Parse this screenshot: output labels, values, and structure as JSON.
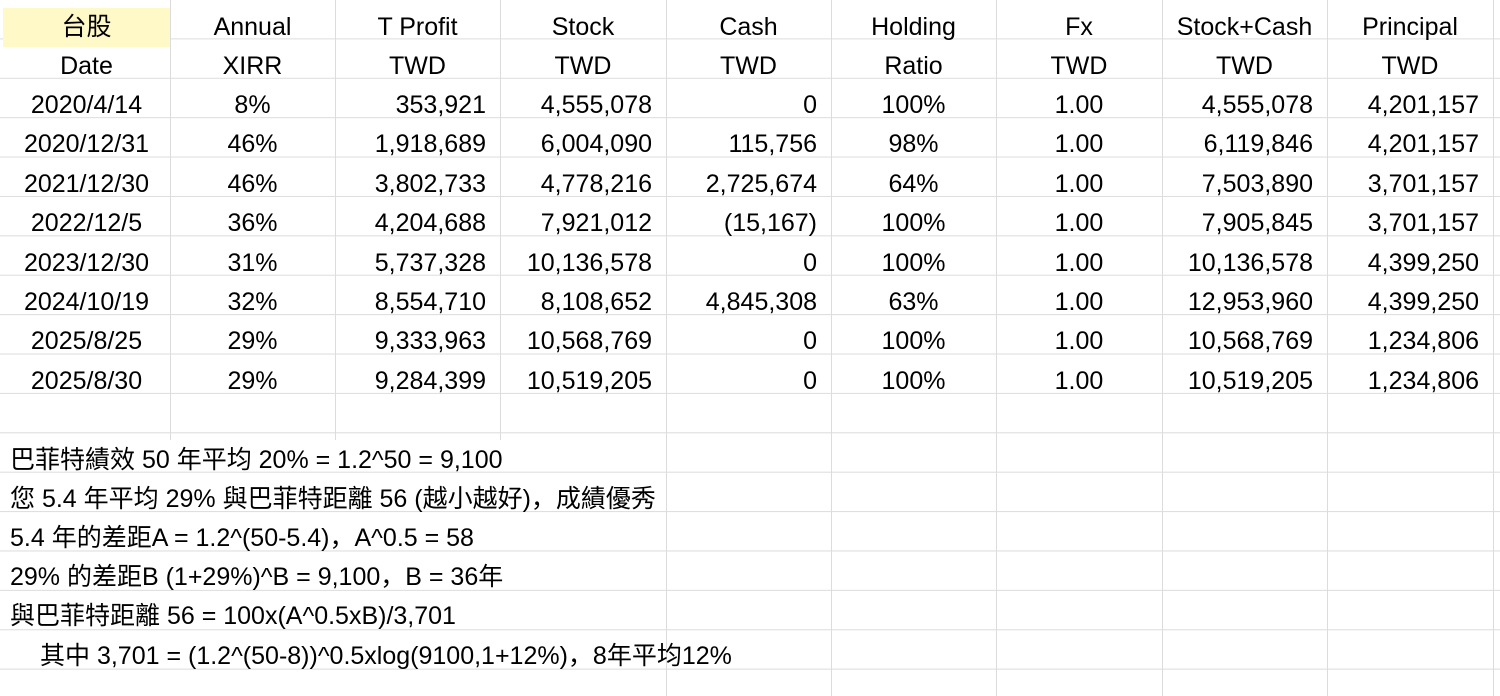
{
  "header": {
    "row1": [
      "台股",
      "Annual",
      "T Profit",
      "Stock",
      "Cash",
      "Holding",
      "Fx",
      "Stock+Cash",
      "Principal"
    ],
    "row2": [
      "Date",
      "XIRR",
      "TWD",
      "TWD",
      "TWD",
      "Ratio",
      "TWD",
      "TWD",
      "TWD"
    ]
  },
  "rows": [
    [
      "2020/4/14",
      "8%",
      "353,921",
      "4,555,078",
      "0",
      "100%",
      "1.00",
      "4,555,078",
      "4,201,157"
    ],
    [
      "2020/12/31",
      "46%",
      "1,918,689",
      "6,004,090",
      "115,756",
      "98%",
      "1.00",
      "6,119,846",
      "4,201,157"
    ],
    [
      "2021/12/30",
      "46%",
      "3,802,733",
      "4,778,216",
      "2,725,674",
      "64%",
      "1.00",
      "7,503,890",
      "3,701,157"
    ],
    [
      "2022/12/5",
      "36%",
      "4,204,688",
      "7,921,012",
      "(15,167)",
      "100%",
      "1.00",
      "7,905,845",
      "3,701,157"
    ],
    [
      "2023/12/30",
      "31%",
      "5,737,328",
      "10,136,578",
      "0",
      "100%",
      "1.00",
      "10,136,578",
      "4,399,250"
    ],
    [
      "2024/10/19",
      "32%",
      "8,554,710",
      "8,108,652",
      "4,845,308",
      "63%",
      "1.00",
      "12,953,960",
      "4,399,250"
    ],
    [
      "2025/8/25",
      "29%",
      "9,333,963",
      "10,568,769",
      "0",
      "100%",
      "1.00",
      "10,568,769",
      "1,234,806"
    ],
    [
      "2025/8/30",
      "29%",
      "9,284,399",
      "10,519,205",
      "0",
      "100%",
      "1.00",
      "10,519,205",
      "1,234,806"
    ]
  ],
  "notes": [
    "巴菲特績效 50 年平均 20% = 1.2^50 = 9,100",
    "您 5.4 年平均 29% 與巴菲特距離 56 (越小越好)，成績優秀",
    "5.4 年的差距A = 1.2^(50-5.4)，A^0.5 = 58",
    "29% 的差距B (1+29%)^B = 9,100，B = 36年",
    "與巴菲特距離 56 = 100x(A^0.5xB)/3,701",
    "其中 3,701 = (1.2^(50-8))^0.5xlog(9100,1+12%)，8年平均12%"
  ],
  "colors": {
    "header_highlight": "#fff9c8",
    "grid": "#dcdcdc"
  }
}
